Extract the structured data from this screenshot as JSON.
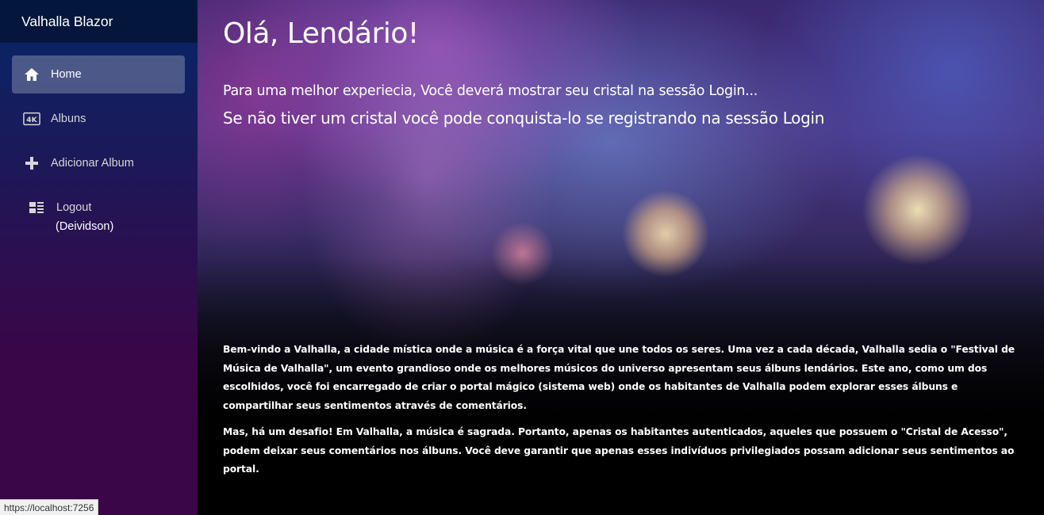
{
  "sidebar": {
    "brand": "Valhalla Blazor",
    "items": [
      {
        "label": "Home",
        "icon": "home-icon",
        "active": true
      },
      {
        "label": "Albuns",
        "icon": "4k-icon",
        "active": false
      },
      {
        "label": "Adicionar Album",
        "icon": "plus-icon",
        "active": false
      },
      {
        "label": "Logout",
        "icon": "list-icon",
        "active": false
      }
    ],
    "user": "(Deividson)"
  },
  "main": {
    "title": "Olá, Lendário!",
    "subtitle1": "Para uma melhor experiecia, Você deverá mostrar seu cristal na sessão Login...",
    "subtitle2": "Se não tiver um cristal você pode conquista-lo se registrando na sessão Login",
    "paragraph1": "Bem-vindo a Valhalla, a cidade mística onde a música é a força vital que une todos os seres. Uma vez a cada década, Valhalla sedia o \"Festival de Música de Valhalla\", um evento grandioso onde os melhores músicos do universo apresentam seus álbuns lendários. Este ano, como um dos escolhidos, você foi encarregado de criar o portal mágico (sistema web) onde os habitantes de Valhalla podem explorar esses álbuns e compartilhar seus sentimentos através de comentários.",
    "paragraph2": "Mas, há um desafio! Em Valhalla, a música é sagrada. Portanto, apenas os habitantes autenticados, aqueles que possuem o \"Cristal de Acesso\", podem deixar seus comentários nos álbuns. Você deve garantir que apenas esses indivíduos privilegiados possam adicionar seus sentimentos ao portal."
  },
  "status_bar": {
    "url": "https://localhost:7256"
  },
  "colors": {
    "sidebar_top": "#052767",
    "sidebar_bottom": "#3a0647",
    "active_item_bg": "rgba(255,255,255,0.25)"
  }
}
